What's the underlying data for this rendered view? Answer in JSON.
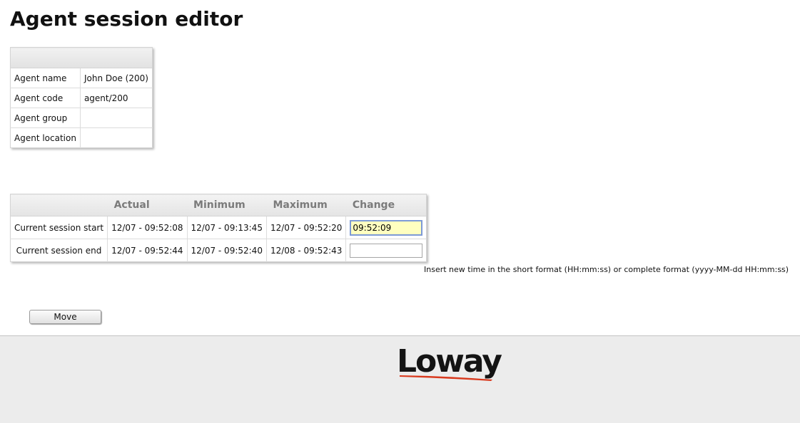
{
  "page": {
    "title": "Agent session editor"
  },
  "agent_info": {
    "rows": [
      {
        "label": "Agent name",
        "value": "John Doe (200)"
      },
      {
        "label": "Agent code",
        "value": "agent/200"
      },
      {
        "label": "Agent group",
        "value": ""
      },
      {
        "label": "Agent location",
        "value": ""
      }
    ]
  },
  "session": {
    "headers": [
      "",
      "Actual",
      "Minimum",
      "Maximum",
      "Change"
    ],
    "rows": [
      {
        "label": "Current session start",
        "actual": "12/07 - 09:52:08",
        "minimum": "12/07 - 09:13:45",
        "maximum": "12/07 - 09:52:20",
        "change": "09:52:09"
      },
      {
        "label": "Current session end",
        "actual": "12/07 - 09:52:44",
        "minimum": "12/07 - 09:52:40",
        "maximum": "12/08 - 09:52:43",
        "change": ""
      }
    ],
    "hint": "Insert new time in the short format (HH:mm:ss) or complete format (yyyy-MM-dd HH:mm:ss)"
  },
  "actions": {
    "move_label": "Move"
  },
  "footer": {
    "logo_text": "Loway",
    "logo_accent_color": "#d93a1e"
  }
}
